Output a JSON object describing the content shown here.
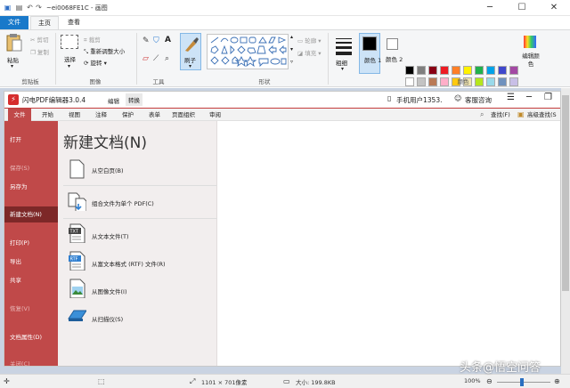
{
  "title_bar": {
    "title": "~ei0068FE1C - 画图"
  },
  "menu_tabs": [
    {
      "label": "文件"
    },
    {
      "label": "主页"
    },
    {
      "label": "查看"
    }
  ],
  "ribbon": {
    "clipboard": {
      "paste": "粘贴",
      "cut": "剪切",
      "copy": "复制",
      "group": "剪贴板"
    },
    "image": {
      "select": "选择",
      "crop": "裁剪",
      "resize": "重新调整大小",
      "rotate": "旋转",
      "group": "图像"
    },
    "tools": {
      "group": "工具"
    },
    "brush": {
      "label": "刷子"
    },
    "shapes": {
      "outline": "轮廓",
      "fill": "填充",
      "group": "形状"
    },
    "size": {
      "label": "粗细"
    },
    "colors": {
      "color1": "颜色 1",
      "color2": "颜色 2",
      "edit": "编辑颜色",
      "group": "颜色",
      "palette": [
        "#000000",
        "#7f7f7f",
        "#880015",
        "#ed1c24",
        "#ff7f27",
        "#fff200",
        "#22b14c",
        "#00a2e8",
        "#3f48cc",
        "#a349a4",
        "#ffffff",
        "#c3c3c3",
        "#b97a57",
        "#ffaec9",
        "#ffc90e",
        "#efe4b0",
        "#b5e61d",
        "#99d9ea",
        "#7092be",
        "#c8bfe7"
      ]
    }
  },
  "pdf_app": {
    "app_name": "闪电PDF编辑器3.0.4",
    "top_tabs": [
      "编辑",
      "转换"
    ],
    "user": "手机用户1353.",
    "support": "客服咨询",
    "menu": [
      "文件",
      "开始",
      "视图",
      "注释",
      "保护",
      "表单",
      "页面组织",
      "审阅"
    ],
    "find": "查找(F)",
    "advanced_find": "高级查找(S",
    "sidebar": [
      {
        "label": "打开",
        "dim": false
      },
      {
        "label": "保存(S)",
        "dim": true
      },
      {
        "label": "另存为",
        "dim": false
      },
      {
        "label": "新建文档(N)",
        "dim": false,
        "active": true
      },
      {
        "label": "打印(P)",
        "dim": false
      },
      {
        "label": "导出",
        "dim": false
      },
      {
        "label": "共享",
        "dim": false
      },
      {
        "label": "恢复(V)",
        "dim": true
      },
      {
        "label": "文档属性(D)",
        "dim": false
      },
      {
        "label": "关闭(C)",
        "dim": true
      }
    ],
    "heading": "新建文档(N)",
    "options": [
      {
        "label": "从空白页(B)"
      },
      {
        "label": "组合文件为单个 PDF(C)"
      },
      {
        "label": "从文本文件(T)"
      },
      {
        "label": "从富文本格式 (RTF) 文件(R)"
      },
      {
        "label": "从图像文件(I)"
      },
      {
        "label": "从扫描仪(S)"
      }
    ],
    "icon_badges": {
      "txt": "TXT",
      "rtf": "RTF"
    }
  },
  "status_bar": {
    "dimensions": "1101 × 701像素",
    "size": "大小: 199.8KB",
    "zoom": "100%"
  },
  "watermark": "头条@悟空问答"
}
